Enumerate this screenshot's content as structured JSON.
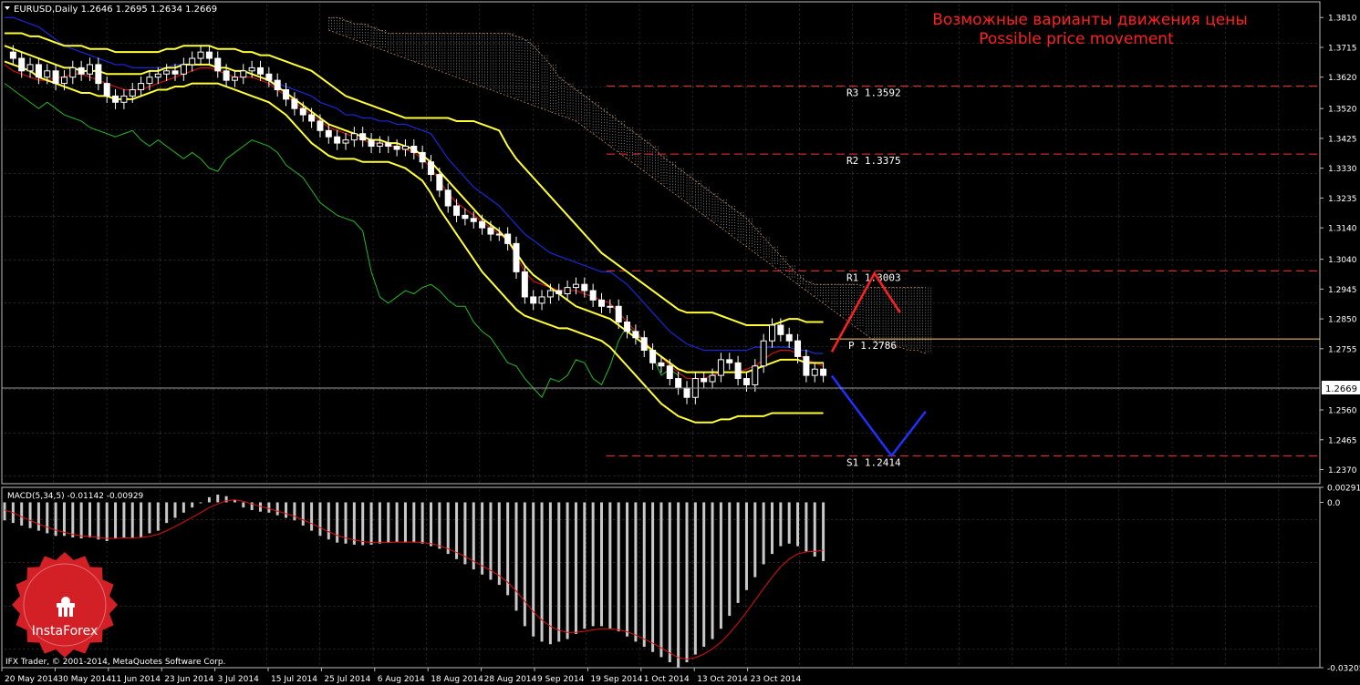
{
  "header": {
    "symbol_line": "EURUSD,Daily  1.2646 1.2695 1.2634 1.2669"
  },
  "annotation": {
    "line_ru": "Возможные варианты движения цены",
    "line_en": "Possible price movement",
    "color": "#ff2020"
  },
  "macd_label": "MACD(5,34,5) -0.01142 -0.00929",
  "copyright": "IFX Trader, © 2001-2014, MetaQuotes Software Corp.",
  "brand": {
    "name": "InstaForex",
    "color": "#d32027",
    "icon": "instaforex-logo-icon"
  },
  "chart_data": {
    "type": "candlestick",
    "price_axis": {
      "ylim": [
        1.2325,
        1.386
      ],
      "tick_labels": [
        "1.3810",
        "1.3715",
        "1.3620",
        "1.3520",
        "1.3425",
        "1.3330",
        "1.3235",
        "1.3140",
        "1.3040",
        "1.2945",
        "1.2850",
        "1.2755",
        "1.2560",
        "1.2465",
        "1.2370"
      ],
      "current_price": "1.2669",
      "current_price_value": 1.2669
    },
    "macd_axis": {
      "ylim": [
        -0.03205,
        0.00291
      ],
      "tick_labels": [
        "0.00291",
        "0.0",
        "-0.03205"
      ]
    },
    "date_labels": [
      "20 May 2014",
      "30 May 2014",
      "11 Jun 2014",
      "23 Jun 2014",
      "3 Jul 2014",
      "15 Jul 2014",
      "25 Jul 2014",
      "6 Aug 2014",
      "18 Aug 2014",
      "28 Aug 2014",
      "9 Sep 2014",
      "19 Sep 2014",
      "1 Oct 2014",
      "13 Oct 2014",
      "23 Oct 2014"
    ],
    "levels": [
      {
        "label": "R3  1.3592",
        "value": 1.3592
      },
      {
        "label": "R2  1.3375",
        "value": 1.3375
      },
      {
        "label": "R1  1.3003",
        "value": 1.3003
      },
      {
        "label": "P  1.2786",
        "value": 1.2786
      },
      {
        "label": "S1  1.2414",
        "value": 1.2414
      }
    ],
    "level_color": "#ff3030",
    "pivot_color": "#ffcc66",
    "price_path": [
      1.37,
      1.368,
      1.364,
      1.366,
      1.362,
      1.364,
      1.36,
      1.362,
      1.365,
      1.363,
      1.366,
      1.36,
      1.356,
      1.354,
      1.356,
      1.358,
      1.36,
      1.362,
      1.363,
      1.364,
      1.363,
      1.366,
      1.368,
      1.37,
      1.368,
      1.364,
      1.361,
      1.362,
      1.364,
      1.365,
      1.363,
      1.361,
      1.358,
      1.355,
      1.352,
      1.35,
      1.348,
      1.345,
      1.343,
      1.341,
      1.342,
      1.344,
      1.342,
      1.34,
      1.341,
      1.34,
      1.339,
      1.34,
      1.338,
      1.335,
      1.331,
      1.326,
      1.321,
      1.318,
      1.317,
      1.316,
      1.314,
      1.312,
      1.312,
      1.309,
      1.3,
      1.292,
      1.29,
      1.292,
      1.294,
      1.293,
      1.295,
      1.296,
      1.294,
      1.291,
      1.289,
      1.289,
      1.284,
      1.281,
      1.279,
      1.275,
      1.271,
      1.27,
      1.266,
      1.263,
      1.26,
      1.266,
      1.265,
      1.267,
      1.272,
      1.271,
      1.266,
      1.264,
      1.27,
      1.278,
      1.283,
      1.28,
      1.278,
      1.273,
      1.267,
      1.269,
      1.267
    ],
    "tenkan": [
      1.366,
      1.364,
      1.363,
      1.362,
      1.361,
      1.361,
      1.362,
      1.362,
      1.363,
      1.363,
      1.362,
      1.361,
      1.36,
      1.359,
      1.358,
      1.358,
      1.358,
      1.359,
      1.36,
      1.361,
      1.362,
      1.363,
      1.364,
      1.365,
      1.365,
      1.364,
      1.363,
      1.362,
      1.362,
      1.362,
      1.361,
      1.36,
      1.358,
      1.356,
      1.354,
      1.352,
      1.35,
      1.348,
      1.346,
      1.345,
      1.344,
      1.343,
      1.342,
      1.341,
      1.341,
      1.34,
      1.34,
      1.339,
      1.338,
      1.336,
      1.333,
      1.329,
      1.325,
      1.322,
      1.32,
      1.318,
      1.316,
      1.314,
      1.312,
      1.31,
      1.305,
      1.3,
      1.297,
      1.296,
      1.295,
      1.294,
      1.294,
      1.294,
      1.293,
      1.292,
      1.291,
      1.29,
      1.287,
      1.284,
      1.281,
      1.278,
      1.275,
      1.273,
      1.27,
      1.268,
      1.266,
      1.266,
      1.266,
      1.267,
      1.268,
      1.268,
      1.268,
      1.269,
      1.27,
      1.272,
      1.274,
      1.275,
      1.275,
      1.274,
      1.272,
      1.271,
      1.27
    ],
    "kijun": [
      1.381,
      1.381,
      1.38,
      1.379,
      1.378,
      1.376,
      1.374,
      1.372,
      1.371,
      1.37,
      1.369,
      1.368,
      1.367,
      1.366,
      1.366,
      1.365,
      1.365,
      1.365,
      1.365,
      1.365,
      1.366,
      1.366,
      1.366,
      1.366,
      1.366,
      1.365,
      1.365,
      1.364,
      1.364,
      1.363,
      1.362,
      1.361,
      1.36,
      1.359,
      1.358,
      1.357,
      1.356,
      1.354,
      1.353,
      1.352,
      1.35,
      1.35,
      1.349,
      1.349,
      1.348,
      1.348,
      1.347,
      1.347,
      1.346,
      1.345,
      1.344,
      1.34,
      1.336,
      1.333,
      1.33,
      1.327,
      1.325,
      1.323,
      1.321,
      1.318,
      1.315,
      1.312,
      1.31,
      1.308,
      1.306,
      1.305,
      1.304,
      1.303,
      1.302,
      1.301,
      1.3,
      1.3,
      1.298,
      1.296,
      1.293,
      1.29,
      1.287,
      1.284,
      1.281,
      1.279,
      1.277,
      1.276,
      1.275,
      1.275,
      1.275,
      1.275,
      1.275,
      1.275,
      1.276,
      1.276,
      1.276,
      1.276,
      1.276,
      1.275,
      1.275,
      1.274,
      1.274
    ],
    "chikou": [
      1.36,
      1.358,
      1.356,
      1.354,
      1.352,
      1.354,
      1.352,
      1.35,
      1.349,
      1.348,
      1.346,
      1.345,
      1.344,
      1.343,
      1.344,
      1.345,
      1.342,
      1.34,
      1.342,
      1.34,
      1.338,
      1.336,
      1.338,
      1.336,
      1.333,
      1.332,
      1.336,
      1.338,
      1.34,
      1.342,
      1.341,
      1.34,
      1.338,
      1.334,
      1.332,
      1.33,
      1.326,
      1.322,
      1.32,
      1.318,
      1.317,
      1.316,
      1.313,
      1.3,
      1.292,
      1.29,
      1.292,
      1.294,
      1.293,
      1.295,
      1.296,
      1.294,
      1.291,
      1.289,
      1.289,
      1.284,
      1.281,
      1.279,
      1.275,
      1.271,
      1.27,
      1.266,
      1.263,
      1.26,
      1.266,
      1.265,
      1.267,
      1.272,
      1.271,
      1.266,
      1.264,
      1.27,
      1.278,
      1.283,
      1.28,
      1.278,
      1.273,
      1.267,
      1.269,
      1.267
    ],
    "bollinger_upper": [
      1.376,
      1.376,
      1.376,
      1.375,
      1.375,
      1.374,
      1.373,
      1.372,
      1.372,
      1.372,
      1.371,
      1.371,
      1.371,
      1.37,
      1.37,
      1.37,
      1.37,
      1.37,
      1.37,
      1.371,
      1.371,
      1.372,
      1.372,
      1.372,
      1.372,
      1.371,
      1.371,
      1.371,
      1.37,
      1.37,
      1.369,
      1.369,
      1.368,
      1.367,
      1.366,
      1.365,
      1.364,
      1.362,
      1.36,
      1.358,
      1.356,
      1.355,
      1.354,
      1.353,
      1.352,
      1.351,
      1.35,
      1.349,
      1.349,
      1.349,
      1.349,
      1.349,
      1.349,
      1.348,
      1.348,
      1.348,
      1.347,
      1.346,
      1.345,
      1.34,
      1.336,
      1.333,
      1.33,
      1.327,
      1.324,
      1.321,
      1.318,
      1.315,
      1.312,
      1.309,
      1.306,
      1.304,
      1.302,
      1.3,
      1.298,
      1.296,
      1.294,
      1.292,
      1.29,
      1.288,
      1.287,
      1.287,
      1.287,
      1.287,
      1.286,
      1.285,
      1.284,
      1.283,
      1.283,
      1.283,
      1.283,
      1.284,
      1.285,
      1.285,
      1.284,
      1.284,
      1.284
    ],
    "bollinger_middle": [
      1.372,
      1.371,
      1.37,
      1.369,
      1.368,
      1.367,
      1.366,
      1.365,
      1.365,
      1.364,
      1.364,
      1.364,
      1.363,
      1.363,
      1.363,
      1.363,
      1.363,
      1.364,
      1.364,
      1.365,
      1.365,
      1.366,
      1.366,
      1.366,
      1.366,
      1.365,
      1.365,
      1.364,
      1.364,
      1.363,
      1.362,
      1.361,
      1.359,
      1.357,
      1.355,
      1.353,
      1.351,
      1.349,
      1.347,
      1.346,
      1.345,
      1.344,
      1.343,
      1.342,
      1.342,
      1.341,
      1.341,
      1.34,
      1.339,
      1.337,
      1.335,
      1.332,
      1.329,
      1.326,
      1.323,
      1.32,
      1.317,
      1.315,
      1.313,
      1.31,
      1.306,
      1.302,
      1.299,
      1.297,
      1.295,
      1.293,
      1.291,
      1.289,
      1.288,
      1.287,
      1.286,
      1.285,
      1.283,
      1.281,
      1.279,
      1.277,
      1.275,
      1.273,
      1.271,
      1.269,
      1.268,
      1.268,
      1.268,
      1.268,
      1.268,
      1.268,
      1.268,
      1.268,
      1.269,
      1.27,
      1.271,
      1.272,
      1.272,
      1.272,
      1.271,
      1.271,
      1.271
    ],
    "bollinger_lower": [
      1.367,
      1.366,
      1.365,
      1.364,
      1.362,
      1.361,
      1.36,
      1.359,
      1.358,
      1.357,
      1.357,
      1.356,
      1.356,
      1.355,
      1.355,
      1.355,
      1.356,
      1.357,
      1.358,
      1.358,
      1.359,
      1.359,
      1.36,
      1.36,
      1.36,
      1.36,
      1.359,
      1.358,
      1.357,
      1.356,
      1.355,
      1.354,
      1.352,
      1.35,
      1.347,
      1.344,
      1.341,
      1.339,
      1.337,
      1.336,
      1.336,
      1.336,
      1.335,
      1.335,
      1.335,
      1.335,
      1.334,
      1.333,
      1.331,
      1.329,
      1.325,
      1.32,
      1.316,
      1.312,
      1.308,
      1.304,
      1.3,
      1.297,
      1.294,
      1.291,
      1.288,
      1.286,
      1.285,
      1.284,
      1.283,
      1.282,
      1.282,
      1.281,
      1.28,
      1.279,
      1.278,
      1.276,
      1.273,
      1.27,
      1.267,
      1.264,
      1.261,
      1.258,
      1.256,
      1.254,
      1.253,
      1.252,
      1.252,
      1.252,
      1.253,
      1.253,
      1.254,
      1.254,
      1.254,
      1.254,
      1.255,
      1.255,
      1.255,
      1.255,
      1.255,
      1.255,
      1.255
    ],
    "cloud_upper": [
      1.381,
      1.381,
      1.38,
      1.379,
      1.379,
      1.378,
      1.377,
      1.376,
      1.376,
      1.376,
      1.376,
      1.376,
      1.376,
      1.376,
      1.376,
      1.376,
      1.376,
      1.376,
      1.376,
      1.376,
      1.376,
      1.376,
      1.375,
      1.374,
      1.372,
      1.369,
      1.366,
      1.362,
      1.36,
      1.358,
      1.356,
      1.354,
      1.352,
      1.35,
      1.348,
      1.346,
      1.344,
      1.342,
      1.34,
      1.337,
      1.335,
      1.333,
      1.331,
      1.329,
      1.327,
      1.325,
      1.323,
      1.321,
      1.319,
      1.317,
      1.314,
      1.311,
      1.308,
      1.305,
      1.302,
      1.299,
      1.297,
      1.296,
      1.296,
      1.296,
      1.296,
      1.296,
      1.296,
      1.295,
      1.295,
      1.295,
      1.295,
      1.295,
      1.295,
      1.295,
      1.295
    ],
    "cloud_lower": [
      1.377,
      1.376,
      1.375,
      1.374,
      1.373,
      1.372,
      1.371,
      1.37,
      1.369,
      1.368,
      1.367,
      1.366,
      1.365,
      1.364,
      1.363,
      1.362,
      1.361,
      1.36,
      1.359,
      1.358,
      1.357,
      1.356,
      1.355,
      1.354,
      1.353,
      1.352,
      1.351,
      1.35,
      1.349,
      1.348,
      1.346,
      1.344,
      1.342,
      1.34,
      1.338,
      1.336,
      1.334,
      1.332,
      1.33,
      1.328,
      1.326,
      1.324,
      1.322,
      1.32,
      1.318,
      1.316,
      1.314,
      1.312,
      1.31,
      1.308,
      1.306,
      1.304,
      1.302,
      1.3,
      1.298,
      1.296,
      1.294,
      1.292,
      1.29,
      1.288,
      1.286,
      1.284,
      1.282,
      1.28,
      1.278,
      1.277,
      1.276,
      1.276,
      1.275,
      1.275,
      1.274
    ],
    "forecast_up": {
      "color": "#ff2020",
      "points": [
        [
          97,
          1.2745
        ],
        [
          102,
          1.2995
        ],
        [
          105,
          1.287
        ]
      ]
    },
    "forecast_down": {
      "color": "#2030ff",
      "points": [
        [
          97,
          1.2669
        ],
        [
          104,
          1.2414
        ],
        [
          108,
          1.2555
        ]
      ]
    },
    "macd_hist": [
      -0.0035,
      -0.004,
      -0.0045,
      -0.005,
      -0.0055,
      -0.006,
      -0.0065,
      -0.0065,
      -0.0068,
      -0.007,
      -0.0068,
      -0.0072,
      -0.0075,
      -0.007,
      -0.0068,
      -0.007,
      -0.0068,
      -0.006,
      -0.0055,
      -0.004,
      -0.003,
      -0.002,
      -0.001,
      0.0,
      0.001,
      0.0015,
      0.0012,
      0.0005,
      -0.001,
      -0.0015,
      -0.0018,
      -0.002,
      -0.0025,
      -0.003,
      -0.0035,
      -0.0045,
      -0.0055,
      -0.0065,
      -0.0072,
      -0.0078,
      -0.008,
      -0.0082,
      -0.0083,
      -0.0082,
      -0.008,
      -0.0078,
      -0.0077,
      -0.0078,
      -0.0078,
      -0.008,
      -0.0085,
      -0.009,
      -0.01,
      -0.011,
      -0.012,
      -0.013,
      -0.014,
      -0.015,
      -0.016,
      -0.018,
      -0.021,
      -0.024,
      -0.026,
      -0.027,
      -0.0275,
      -0.027,
      -0.0265,
      -0.0255,
      -0.0245,
      -0.024,
      -0.024,
      -0.0245,
      -0.025,
      -0.026,
      -0.027,
      -0.028,
      -0.029,
      -0.03,
      -0.031,
      -0.032,
      -0.031,
      -0.0295,
      -0.028,
      -0.0265,
      -0.0245,
      -0.022,
      -0.0195,
      -0.017,
      -0.0145,
      -0.012,
      -0.01,
      -0.0085,
      -0.008,
      -0.0085,
      -0.0095,
      -0.0105,
      -0.0114
    ],
    "macd_signal": [
      -0.0015,
      -0.002,
      -0.0028,
      -0.0035,
      -0.0042,
      -0.0048,
      -0.0054,
      -0.0058,
      -0.0062,
      -0.0065,
      -0.0066,
      -0.0068,
      -0.007,
      -0.007,
      -0.0069,
      -0.0069,
      -0.0068,
      -0.0066,
      -0.0062,
      -0.0055,
      -0.0047,
      -0.0038,
      -0.0029,
      -0.002,
      -0.001,
      -0.0003,
      0.0003,
      0.0005,
      0.0002,
      -0.0003,
      -0.0008,
      -0.0012,
      -0.0017,
      -0.0022,
      -0.0027,
      -0.0034,
      -0.0041,
      -0.0049,
      -0.0057,
      -0.0064,
      -0.0069,
      -0.0073,
      -0.0076,
      -0.0078,
      -0.0078,
      -0.0078,
      -0.0077,
      -0.0077,
      -0.0077,
      -0.0078,
      -0.008,
      -0.0084,
      -0.009,
      -0.0097,
      -0.0105,
      -0.0114,
      -0.0123,
      -0.0132,
      -0.0142,
      -0.0155,
      -0.0172,
      -0.0192,
      -0.0212,
      -0.0228,
      -0.024,
      -0.0248,
      -0.0252,
      -0.0252,
      -0.025,
      -0.0247,
      -0.0245,
      -0.0245,
      -0.0247,
      -0.0251,
      -0.0257,
      -0.0265,
      -0.0273,
      -0.0282,
      -0.0292,
      -0.0301,
      -0.0304,
      -0.0301,
      -0.0294,
      -0.0284,
      -0.0271,
      -0.0254,
      -0.0234,
      -0.0213,
      -0.019,
      -0.0167,
      -0.0145,
      -0.0125,
      -0.011,
      -0.01,
      -0.0096,
      -0.0095,
      -0.0093
    ]
  }
}
